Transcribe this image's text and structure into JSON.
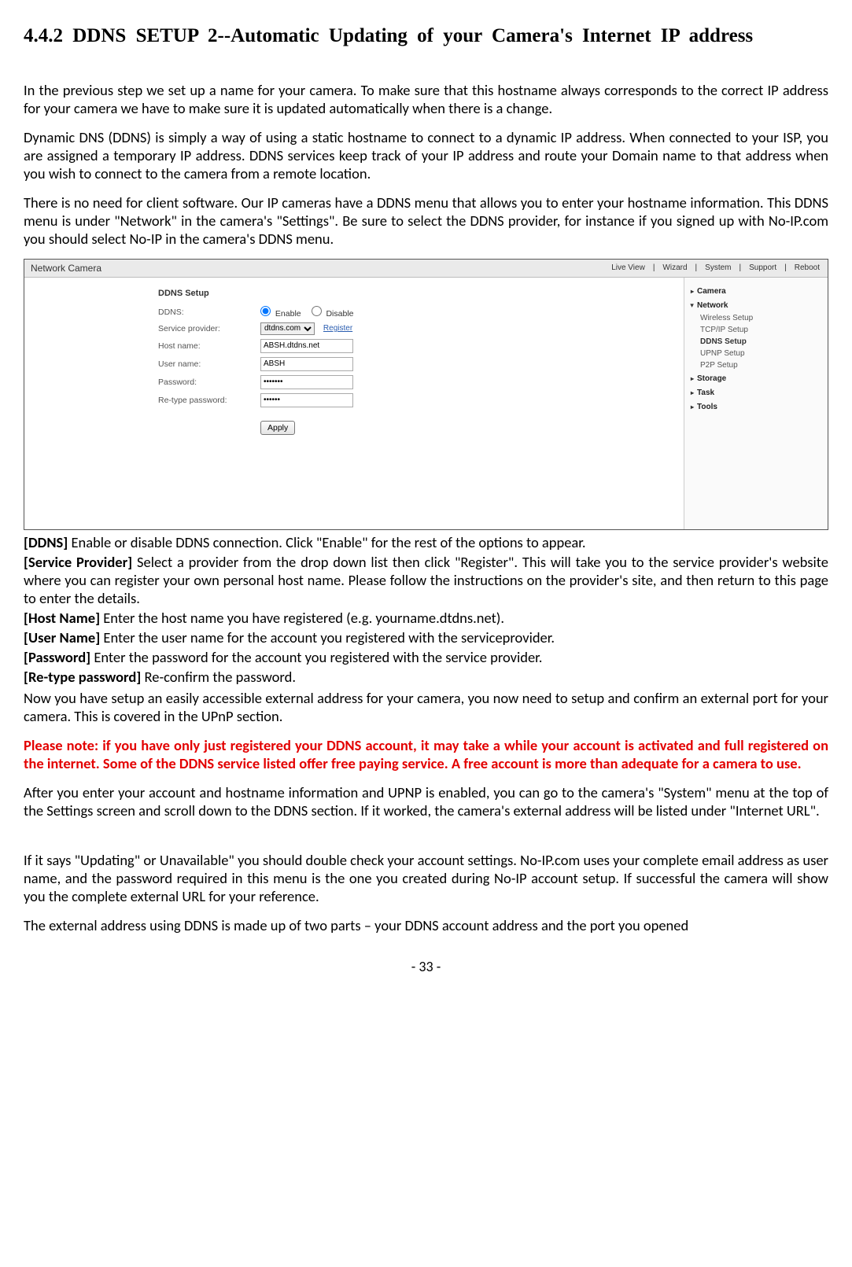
{
  "section_title": "4.4.2 DDNS SETUP 2--Automatic Updating of your Camera's Internet IP address",
  "paras": {
    "p1": "In the previous step we set up a name for your camera. To make sure that this hostname always corresponds to the correct IP address for your camera we have to make sure it is updated automatically when there is a change.",
    "p2": "Dynamic DNS (DDNS) is simply a way of using a static hostname to connect to a dynamic IP address. When connected to your ISP, you are assigned a temporary IP address. DDNS services keep track of your IP address and route your Domain name to that address when you wish to connect to the camera from a remote location.",
    "p3": "There is no need for client software. Our IP cameras have a DDNS menu that allows you to enter your hostname information. This DDNS menu is under \"Network\" in the camera's \"Settings\". Be sure to select the DDNS provider, for instance if you signed up with No-IP.com you should select No-IP in the camera's DDNS menu."
  },
  "screenshot": {
    "title": "Network Camera",
    "menu": [
      "Live View",
      "|",
      "Wizard",
      "|",
      "System",
      "|",
      "Support",
      "|",
      "Reboot"
    ],
    "form_title": "DDNS Setup",
    "rows": {
      "ddns_label": "DDNS:",
      "enable": "Enable",
      "disable": "Disable",
      "sp_label": "Service provider:",
      "sp_value": "dtdns.com",
      "register": "Register",
      "hn_label": "Host name:",
      "hn_value": "ABSH.dtdns.net",
      "un_label": "User name:",
      "un_value": "ABSH",
      "pw_label": "Password:",
      "pw_value": "•••••••",
      "rpw_label": "Re-type password:",
      "rpw_value": "••••••"
    },
    "apply": "Apply",
    "sidebar": {
      "cat1": "Camera",
      "cat2": "Network",
      "subs": [
        "Wireless Setup",
        "TCP/IP Setup",
        "DDNS Setup",
        "UPNP Setup",
        "P2P Setup"
      ],
      "cat3": "Storage",
      "cat4": "Task",
      "cat5": "Tools"
    }
  },
  "defs": {
    "d1_label": "[DDNS] ",
    "d1_text": "Enable or disable DDNS connection. Click \"Enable\" for the rest of the options to appear.",
    "d2_label": "[Service Provider] ",
    "d2_text": "Select a provider from the drop down list then click \"Register\". This will take you to the service provider's website where you can register your own personal host name. Please follow the instructions on the provider's site, and then return to this page to enter the details.",
    "d3_label": "[Host Name] ",
    "d3_text": "Enter the host name you have registered (e.g. yourname.dtdns.net).",
    "d4_label": "[User Name] ",
    "d4_text": "Enter the user name for the account you registered with the serviceprovider.",
    "d5_label": "[Password] ",
    "d5_text": "Enter the password for the account you registered with the service provider.",
    "d6_label": "[Re-type password] ",
    "d6_text": "Re-confirm the password."
  },
  "post_paras": {
    "pp1": "Now you have setup an easily accessible external address for your camera, you now need to setup and confirm an external port for your camera. This is covered in the UPnP section.",
    "note": "Please note: if you have only just registered your DDNS account, it may take a while your account is activated and full registered on the internet. Some of the DDNS service listed offer free paying service. A free account is more than adequate for a camera to use.",
    "pp2": "After you enter your account and hostname information and UPNP is enabled, you can go to the camera's \"System\" menu at the top of the Settings screen and scroll down to the DDNS section. If it worked, the camera's external address will be listed under \"Internet URL\".",
    "pp3": "If it says \"Updating\" or Unavailable\" you should double check your account settings. No-IP.com uses your complete email address as user name, and the password required in this menu is the one you created during No-IP account setup. If successful the camera will show you the complete external URL for your reference.",
    "pp4": "The external address using DDNS is made up of two parts – your DDNS account address and the port you opened"
  },
  "page_number": "- 33 -"
}
